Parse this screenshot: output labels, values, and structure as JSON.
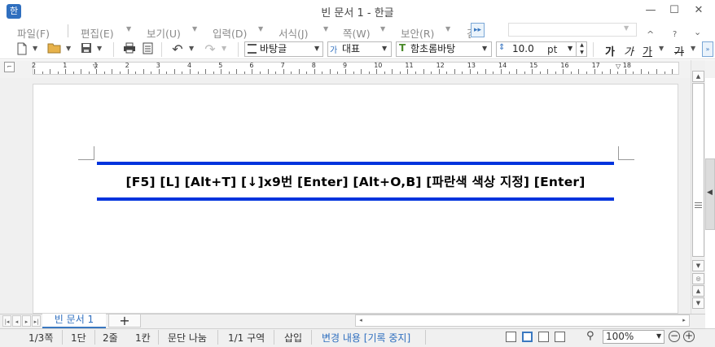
{
  "window": {
    "title": "빈 문서 1 - 한글",
    "app_icon": "한",
    "minimize": "—",
    "maximize": "☐",
    "close": "✕"
  },
  "menu": {
    "items": [
      {
        "label": "파일(F)"
      },
      {
        "label": "편집(E)"
      },
      {
        "label": "보기(U)"
      },
      {
        "label": "입력(D)"
      },
      {
        "label": "서식(J)"
      },
      {
        "label": "쪽(W)"
      },
      {
        "label": "보안(R)"
      },
      {
        "label": "검"
      }
    ],
    "right_icons": {
      "collapse": "^",
      "help": "?",
      "dropdown": "⌄"
    }
  },
  "toolbar": {
    "style_combo": "바탕글",
    "lang_combo": "대표",
    "font_combo": "함초롬바탕",
    "size_value": "10.0",
    "size_unit": "pt",
    "bold": "가",
    "italic": "가",
    "underline": "가",
    "strike": "가"
  },
  "ruler": {
    "numbers": [
      "2",
      "1",
      "1",
      "2",
      "3",
      "4",
      "5",
      "6",
      "7",
      "8",
      "9",
      "10",
      "11",
      "12",
      "13",
      "14",
      "15",
      "16",
      "17",
      "18"
    ]
  },
  "document": {
    "text": "[F5] [L] [Alt+T] [↓]x9번 [Enter] [Alt+O,B] [파란색 색상 지정] [Enter]",
    "line_color": "#0033dd"
  },
  "tabs": {
    "doc_tab": "빈 문서 1",
    "add": "+"
  },
  "status": {
    "page": "1/3쪽",
    "column": "1단",
    "line": "2줄",
    "cell": "1칸",
    "paragraph_break": "문단 나눔",
    "section": "1/1 구역",
    "insert_mode": "삽입",
    "track_changes": "변경 내용 [기록 중지]",
    "zoom": "100%"
  }
}
